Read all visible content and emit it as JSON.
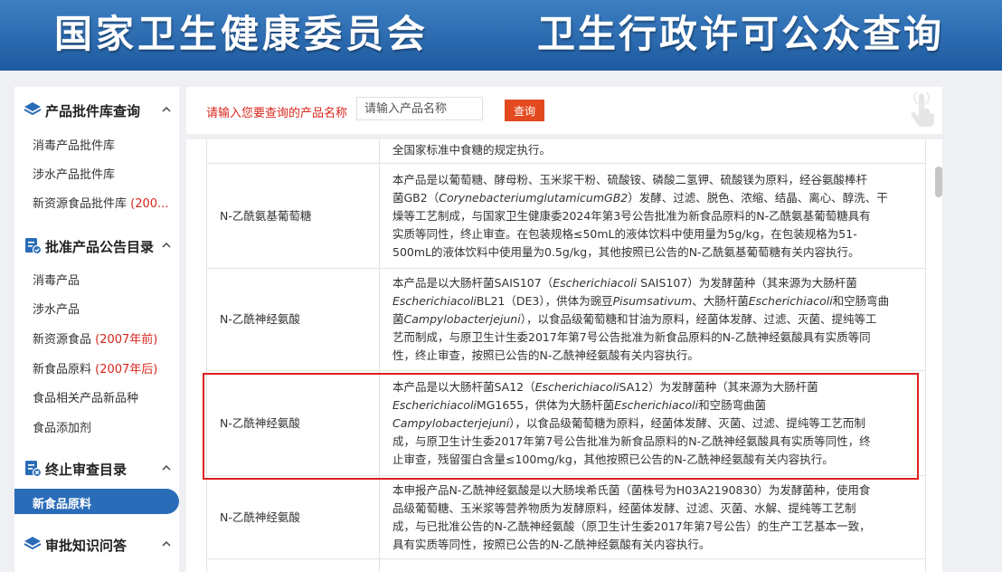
{
  "banner": {
    "agency": "国家卫生健康委员会",
    "system": "卫生行政许可公众查询"
  },
  "sidebar": {
    "section1": {
      "title": "产品批件库查询",
      "items": [
        {
          "label": "消毒产品批件库"
        },
        {
          "label": "涉水产品批件库"
        },
        {
          "label": "新资源食品批件库 ",
          "note": "(200..."
        }
      ]
    },
    "section2": {
      "title": "批准产品公告目录",
      "items": [
        {
          "label": "消毒产品"
        },
        {
          "label": "涉水产品"
        },
        {
          "label": "新资源食品 ",
          "note": "(2007年前)"
        },
        {
          "label": "新食品原料 ",
          "note": "(2007年后)"
        },
        {
          "label": "食品相关产品新品种"
        },
        {
          "label": "食品添加剂"
        }
      ]
    },
    "section3": {
      "title": "终止审查目录",
      "active_item": "新食品原料"
    },
    "section4": {
      "title": "审批知识问答"
    }
  },
  "search": {
    "label": "请输入您要查询的产品名称",
    "placeholder": "请输入产品名称",
    "button": "查询"
  },
  "table": {
    "rows": [
      {
        "name": "",
        "lines": [
          [
            "全国家标准中食糖的规定执行。"
          ]
        ]
      },
      {
        "name": "N-乙酰氨基葡萄糖",
        "lines": [
          [
            "本产品是以葡萄糖、酵母粉、玉米浆干粉、硫酸铵、磷酸二氢钾、硫酸镁为原料，经谷氨酸棒杆"
          ],
          [
            "菌GB2（",
            {
              "i": "CorynebacteriumglutamicumGB2"
            },
            "）发酵、过滤、脱色、浓缩、结晶、离心、醇洗、干"
          ],
          [
            "燥等工艺制成，与国家卫生健康委2024年第3号公告批准为新食品原料的N-乙酰氨基葡萄糖具有"
          ],
          [
            "实质等同性，终止审查。在包装规格≤50mL的液体饮料中使用量为5g/kg，在包装规格为51-"
          ],
          [
            "500mL的液体饮料中使用量为0.5g/kg，其他按照已公告的N-乙酰氨基葡萄糖有关内容执行。"
          ]
        ]
      },
      {
        "name": "N-乙酰神经氨酸",
        "lines": [
          [
            "本产品是以大肠杆菌SAIS107（",
            {
              "i": "Escherichiacoli"
            },
            " SAIS107）为发酵菌种（其来源为大肠杆菌"
          ],
          [
            {
              "i": "Escherichiacoli"
            },
            "BL21（DE3），供体为豌豆",
            {
              "i": "Pisumsativum"
            },
            "、大肠杆菌",
            {
              "i": "Escherichiacoli"
            },
            "和空肠弯曲"
          ],
          [
            "菌",
            {
              "i": "Campylobacterjejuni"
            },
            "），以食品级葡萄糖和甘油为原料，经菌体发酵、过滤、灭菌、提纯等工"
          ],
          [
            "艺而制成，与原卫生计生委2017年第7号公告批准为新食品原料的N-乙酰神经氨酸具有实质等同"
          ],
          [
            "性，终止审查，按照已公告的N-乙酰神经氨酸有关内容执行。"
          ]
        ]
      },
      {
        "name": "N-乙酰神经氨酸",
        "lines": [
          [
            "本产品是以大肠杆菌SA12（",
            {
              "i": "Escherichiacoli"
            },
            "SA12）为发酵菌种（其来源为大肠杆菌"
          ],
          [
            {
              "i": "Escherichiacoli"
            },
            "MG1655，供体为大肠杆菌",
            {
              "i": "Escherichiacoli"
            },
            "和空肠弯曲菌"
          ],
          [
            {
              "i": "Campylobacterjejuni"
            },
            "），以食品级葡萄糖为原料，经菌体发酵、灭菌、过滤、提纯等工艺而制"
          ],
          [
            "成，与原卫生计生委2017年第7号公告批准为新食品原料的N-乙酰神经氨酸具有实质等同性，终"
          ],
          [
            "止审查，残留蛋白含量≤100mg/kg，其他按照已公告的N-乙酰神经氨酸有关内容执行。"
          ]
        ]
      },
      {
        "name": "N-乙酰神经氨酸",
        "lines": [
          [
            "本申报产品N-乙酰神经氨酸是以大肠埃希氏菌（菌株号为H03A2190830）为发酵菌种，使用食"
          ],
          [
            "品级葡萄糖、玉米浆等营养物质为发酵原料，经菌体发酵、过滤、灭菌、水解、提纯等工艺制"
          ],
          [
            "成，与已批准公告的N-乙酰神经氨酸（原卫生计生委2017年第7号公告）的生产工艺基本一致，"
          ],
          [
            "具有实质等同性，按照已公告的N-乙酰神经氨酸有关内容执行。"
          ]
        ]
      },
      {
        "name": "",
        "lines": [
          [
            ""
          ]
        ]
      }
    ]
  },
  "colors": {
    "banner": "#2b6cb8",
    "accent_red": "#d8261c",
    "button": "#e34a20",
    "active_item": "#2b6cb8",
    "highlight_border": "#e02020"
  }
}
